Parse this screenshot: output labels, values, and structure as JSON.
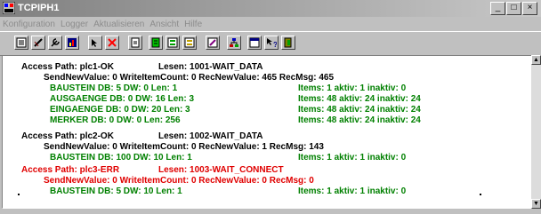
{
  "window": {
    "title": "TCPIPH1"
  },
  "window_buttons": [
    "_",
    "□",
    "×"
  ],
  "menu": [
    "Konfiguration",
    "Logger",
    "Aktualisieren",
    "Ansicht",
    "Hilfe"
  ],
  "toolbar": {
    "buttons": [
      "list-icon",
      "pencil-icon",
      "wrench-icon",
      "bar-chart-icon",
      "cursor-icon",
      "delete-x-icon",
      "document-icon",
      "green-document-icon",
      "green-list-icon",
      "yellow-list-icon",
      "edit-icon",
      "network-icon",
      "window-icon",
      "help-cursor-icon",
      "exit-icon"
    ]
  },
  "colors": {
    "ok": "#008000",
    "error": "#e00000",
    "text": "#000000"
  },
  "log": {
    "lines": [
      {
        "a": "Access Path: plc1-OK",
        "b": "Lesen: 1001-WAIT_DATA"
      },
      {
        "a": "SendNewValue: 0  WriteItemCount: 0  RecNewValue: 465  RecMsg: 465"
      },
      {
        "a": "BAUSTEIN   DB:  5   DW:  0   Len:  1",
        "b": "Items:  1   aktiv:  1   inaktiv:  0"
      },
      {
        "a": "AUSGAENGE   DB:  0   DW: 16   Len:  3",
        "b": "Items:  48   aktiv:  24   inaktiv:  24"
      },
      {
        "a": "EINGAENGE   DB:  0   DW:  20   Len:  3",
        "b": "Items:  48   aktiv:  24   inaktiv:  24"
      },
      {
        "a": "MERKER   DB:  0   DW:  0   Len:  256",
        "b": "Items:  48   aktiv:  24   inaktiv:  24"
      },
      {
        "a": "Access Path: plc2-OK",
        "b": "Lesen: 1002-WAIT_DATA"
      },
      {
        "a": "SendNewValue: 0  WriteItemCount: 0  RecNewValue: 1  RecMsg: 143"
      },
      {
        "a": "BAUSTEIN   DB: 100   DW:  10   Len:  1",
        "b": "Items:  1   aktiv:  1   inaktiv:  0"
      },
      {
        "a": "Access Path: plc3-ERR",
        "b": "Lesen: 1003-WAIT_CONNECT"
      },
      {
        "a": "SendNewValue: 0  WriteItemCount: 0  RecNewValue: 0  RecMsg: 0"
      },
      {
        "a": "BAUSTEIN   DB:  5   DW:  10   Len:  1",
        "b": "Items:  1   aktiv:  1   inaktiv:  0"
      }
    ]
  },
  "scrollbar": {
    "up": "▲",
    "down": "▼"
  }
}
